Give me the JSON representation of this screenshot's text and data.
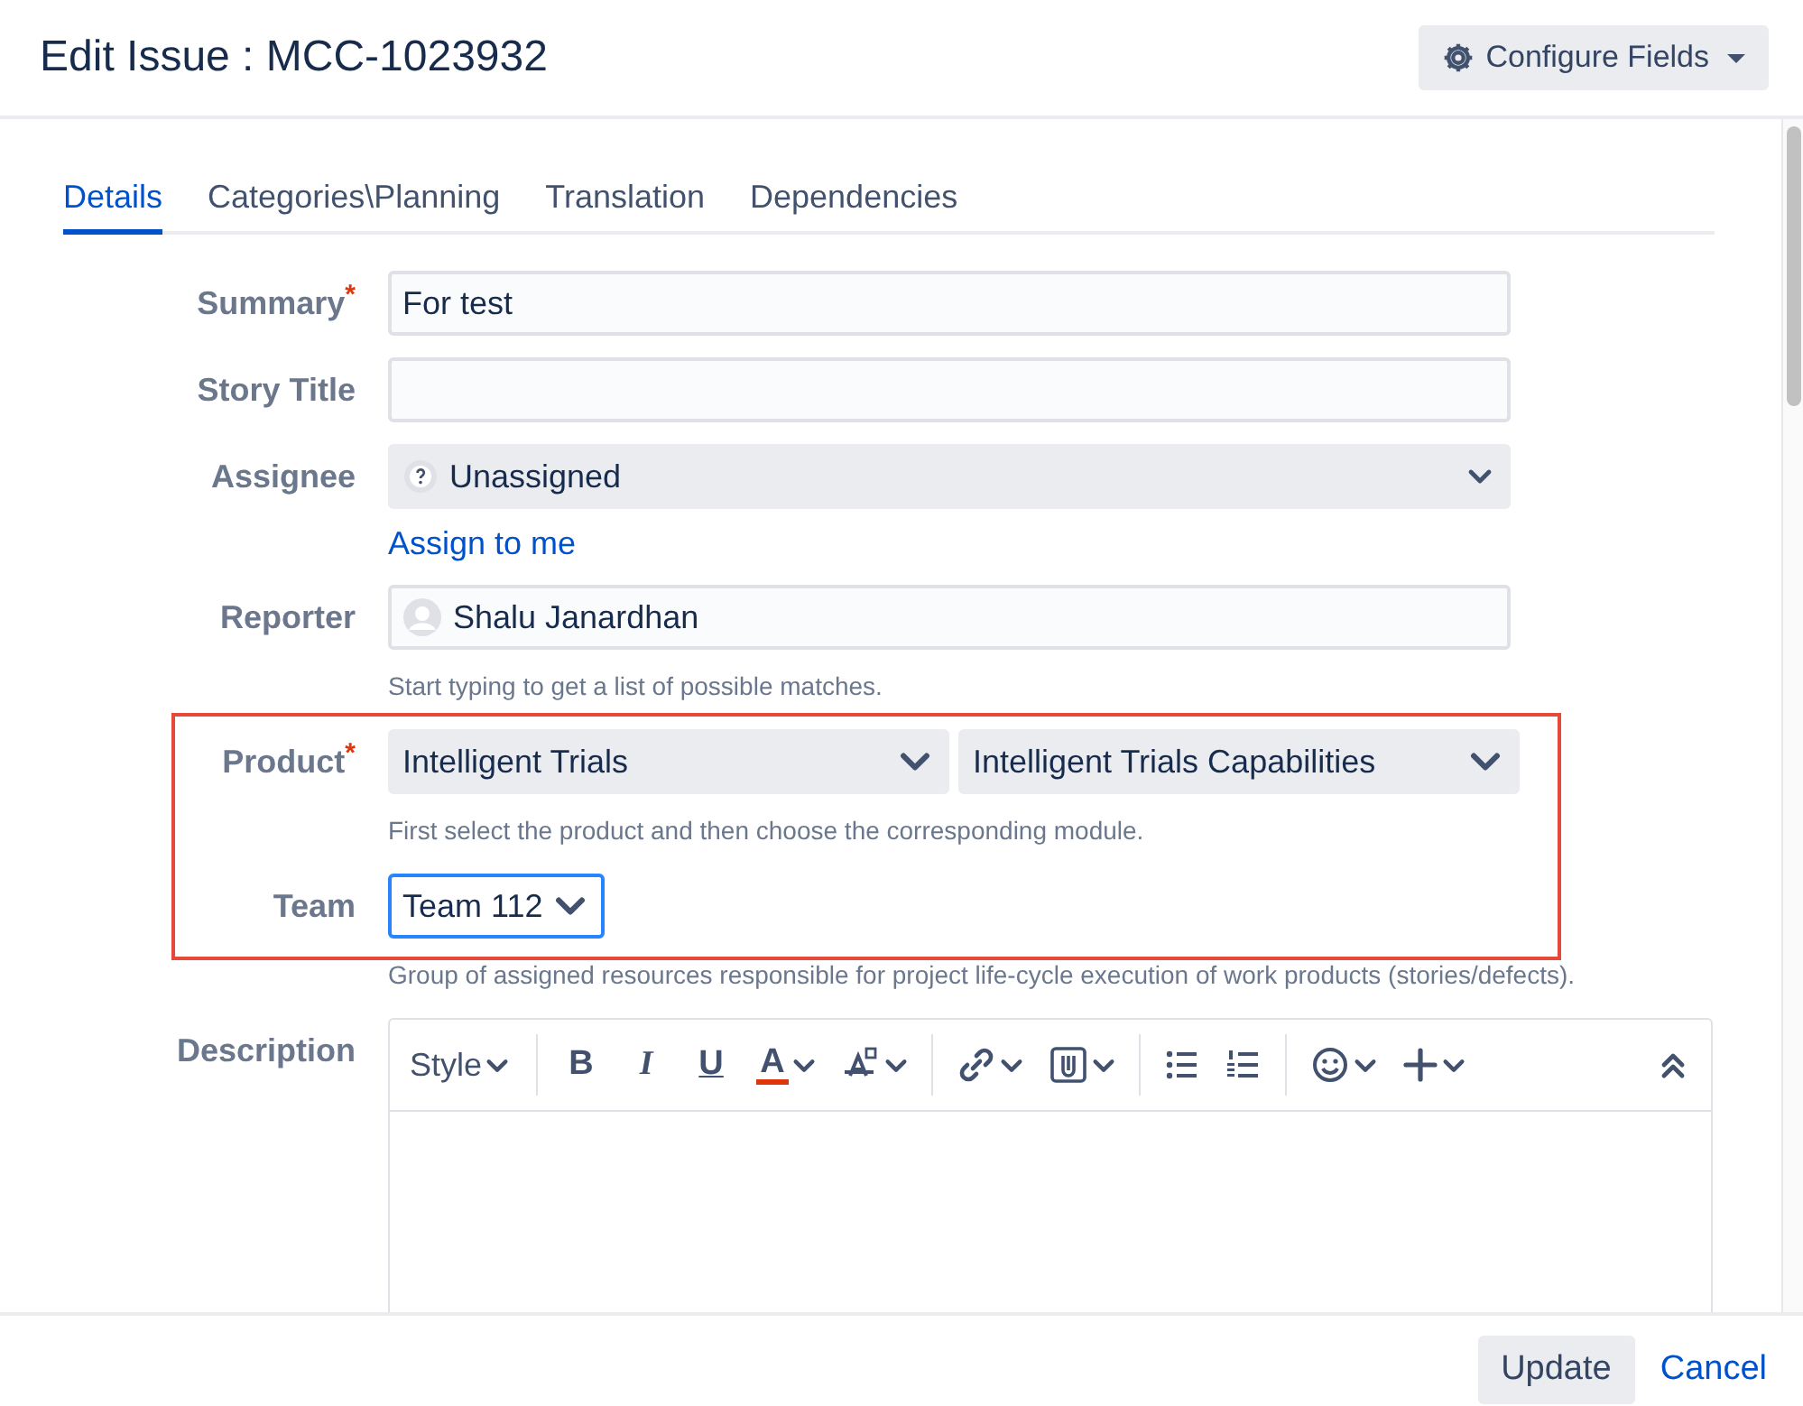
{
  "header": {
    "title": "Edit Issue : MCC-1023932",
    "configure_button": "Configure Fields"
  },
  "tabs": [
    {
      "label": "Details",
      "selected": true
    },
    {
      "label": "Categories\\Planning",
      "selected": false
    },
    {
      "label": "Translation",
      "selected": false
    },
    {
      "label": "Dependencies",
      "selected": false
    }
  ],
  "fields": [
    {
      "kind": "text",
      "label": "Summary",
      "required_marker": "*",
      "value": "For test",
      "focused": false
    },
    {
      "kind": "text",
      "label": "Story Title",
      "focused": false
    },
    {
      "kind": "user-select",
      "label": "Assignee",
      "value": "Unassigned",
      "link": "Assign to me",
      "focused": false
    },
    {
      "kind": "user-picker",
      "label": "Reporter",
      "value": "Shalu Janardhan",
      "hint": "Start typing to get a list of possible matches.",
      "focused": false
    },
    {
      "kind": "dual-select",
      "label": "Product",
      "required_marker": "*",
      "values": [
        "Intelligent Trials",
        "Intelligent Trials Capabilities"
      ],
      "hint": "First select the product and then choose the corresponding module.",
      "focused": false,
      "annotated": true
    },
    {
      "kind": "select",
      "label": "Team",
      "value": "Team 112",
      "hint": "Group of assigned resources responsible for project life-cycle execution of work products (stories/defects).",
      "focused": true,
      "annotated": true
    },
    {
      "kind": "editor",
      "label": "Description",
      "focused": false
    }
  ],
  "editor_toolbar": [
    [
      {
        "kind": "style",
        "text": "Style",
        "menu": true
      }
    ],
    [
      {
        "kind": "bold",
        "text": "B",
        "menu": false
      },
      {
        "kind": "italic",
        "text": "I",
        "menu": false
      },
      {
        "kind": "underline",
        "text": "U",
        "menu": false
      },
      {
        "kind": "text-color",
        "text": "A",
        "menu": true
      },
      {
        "kind": "clear-format",
        "menu": true
      }
    ],
    [
      {
        "kind": "link",
        "menu": true
      },
      {
        "kind": "attachment",
        "menu": true
      }
    ],
    [
      {
        "kind": "bullet-list",
        "menu": false
      },
      {
        "kind": "numbered-list",
        "menu": false
      }
    ],
    [
      {
        "kind": "emoji",
        "menu": true
      },
      {
        "kind": "insert",
        "menu": true
      }
    ]
  ],
  "footer": {
    "update_button": "Update",
    "cancel_link": "Cancel"
  }
}
